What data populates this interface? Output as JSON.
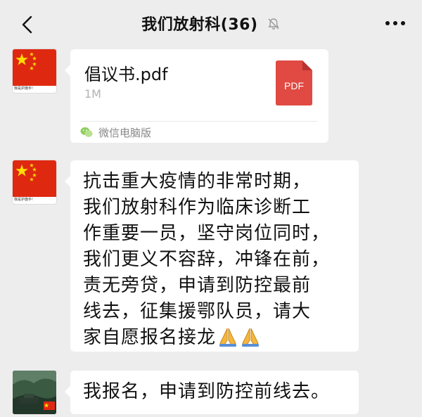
{
  "header": {
    "title": "我们放射科",
    "member_count": "(36)"
  },
  "messages": [
    {
      "type": "file",
      "sender_avatar_caption": "我是护旗手!",
      "file_name": "倡议书.pdf",
      "file_size": "1M",
      "file_badge": "PDF",
      "source": "微信电脑版"
    },
    {
      "type": "text",
      "sender_avatar_caption": "我是护旗手!",
      "text": "抗击重大疫情的非常时期，\n我们放射科作为临床诊断工\n作重要一员，坚守岗位同时，\n我们更义不容辞，冲锋在前，\n责无旁贷，申请到防控最前\n线去，征集援鄂队员，请大\n家自愿报名接龙",
      "emoji": [
        "folded-hands",
        "folded-hands"
      ]
    },
    {
      "type": "text",
      "text": "我报名，申请到防控前线去。"
    }
  ],
  "colors": {
    "background": "#ededed",
    "bubble": "#ffffff",
    "pdf_red": "#e04a43",
    "flag_red": "#de2910",
    "flag_star": "#ffde00"
  }
}
